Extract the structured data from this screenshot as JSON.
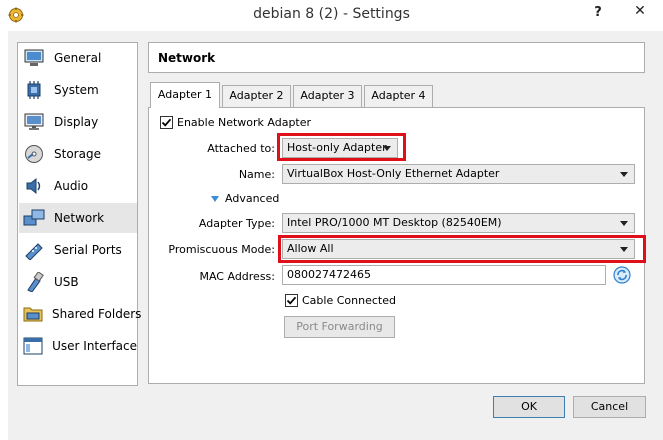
{
  "window": {
    "title": "debian 8 (2) - Settings",
    "help_label": "?",
    "close_label": "✕"
  },
  "sidebar": {
    "items": [
      {
        "label": "General",
        "icon": "general-icon"
      },
      {
        "label": "System",
        "icon": "system-icon"
      },
      {
        "label": "Display",
        "icon": "display-icon"
      },
      {
        "label": "Storage",
        "icon": "storage-icon"
      },
      {
        "label": "Audio",
        "icon": "audio-icon"
      },
      {
        "label": "Network",
        "icon": "network-icon"
      },
      {
        "label": "Serial Ports",
        "icon": "serial-ports-icon"
      },
      {
        "label": "USB",
        "icon": "usb-icon"
      },
      {
        "label": "Shared Folders",
        "icon": "shared-folders-icon"
      },
      {
        "label": "User Interface",
        "icon": "user-interface-icon"
      }
    ],
    "selected": "Network"
  },
  "header": {
    "title": "Network"
  },
  "tabs": [
    {
      "label": "Adapter 1"
    },
    {
      "label": "Adapter 2"
    },
    {
      "label": "Adapter 3"
    },
    {
      "label": "Adapter 4"
    }
  ],
  "adapter": {
    "enable_label": "Enable Network Adapter",
    "attached_label": "Attached to:",
    "attached_value": "Host-only Adapter",
    "name_label": "Name:",
    "name_value": "VirtualBox Host-Only Ethernet Adapter",
    "advanced_label": "Advanced",
    "adapter_type_label": "Adapter Type:",
    "adapter_type_value": "Intel PRO/1000 MT Desktop (82540EM)",
    "promiscuous_label": "Promiscuous Mode:",
    "promiscuous_value": "Allow All",
    "mac_label": "MAC Address:",
    "mac_value": "080027472465",
    "cable_label": "Cable Connected",
    "port_forwarding_label": "Port Forwarding"
  },
  "footer": {
    "ok_label": "OK",
    "cancel_label": "Cancel"
  },
  "colors": {
    "highlight_box": "#e0101a",
    "selected_item_bg": "#e6e6e6"
  }
}
